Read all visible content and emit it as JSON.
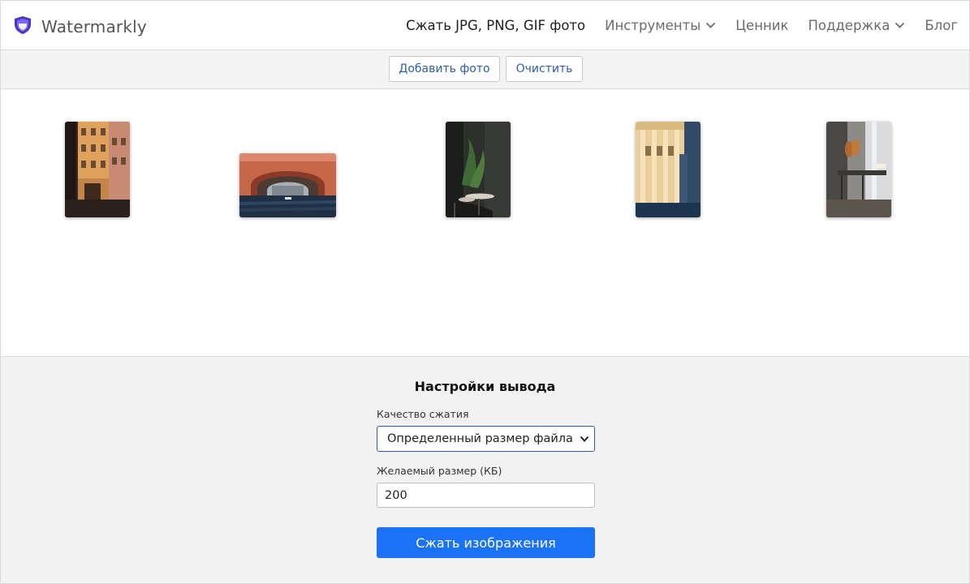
{
  "header": {
    "brand_name": "Watermarkly",
    "nav": [
      {
        "label": "Сжать JPG, PNG, GIF фото",
        "active": true
      },
      {
        "label": "Инструменты",
        "has_dropdown": true
      },
      {
        "label": "Ценник"
      },
      {
        "label": "Поддержка",
        "has_dropdown": true
      },
      {
        "label": "Блог"
      }
    ]
  },
  "toolbar": {
    "add_label": "Добавить фото",
    "clear_label": "Очистить"
  },
  "gallery": {
    "thumbnails": [
      {
        "subject": "street-buildings-photo"
      },
      {
        "subject": "canal-arch-photo"
      },
      {
        "subject": "cafe-interior-photo"
      },
      {
        "subject": "classical-building-photo"
      },
      {
        "subject": "kitchen-interior-photo"
      }
    ]
  },
  "settings": {
    "title": "Настройки вывода",
    "quality_label": "Качество сжатия",
    "quality_value": "Определенный размер файла",
    "size_label": "Желаемый размер (КБ)",
    "size_value": "200",
    "submit_label": "Сжать изображения"
  },
  "colors": {
    "accent": "#1a73f5",
    "link": "#2a5fa8",
    "logo": "#5b3fd6"
  },
  "icons": [
    "shield-logo-icon",
    "chevron-down-icon"
  ]
}
